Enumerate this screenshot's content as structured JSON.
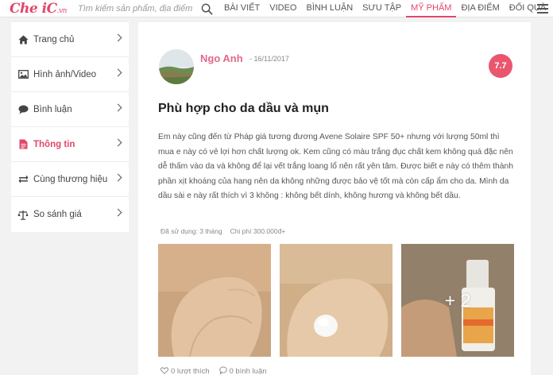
{
  "header": {
    "logo_main": "Che iC",
    "logo_suffix": ".vn",
    "search_placeholder": "Tìm kiếm sản phẩm, địa điểm",
    "nav": [
      {
        "label": "BÀI VIẾT"
      },
      {
        "label": "VIDEO"
      },
      {
        "label": "BÌNH LUẬN"
      },
      {
        "label": "SƯU TẬP"
      },
      {
        "label": "MỸ PHẨM",
        "active": true
      },
      {
        "label": "ĐỊA ĐIỂM"
      },
      {
        "label": "ĐỔI QUÀ"
      }
    ]
  },
  "sidebar": {
    "items": [
      {
        "label": "Trang chủ",
        "icon": "home-icon"
      },
      {
        "label": "Hình ảnh/Video",
        "icon": "image-icon"
      },
      {
        "label": "Bình luận",
        "icon": "comment-icon"
      },
      {
        "label": "Thông tin",
        "icon": "document-icon",
        "active": true
      },
      {
        "label": "Cùng thương hiệu",
        "icon": "exchange-icon"
      },
      {
        "label": "So sánh giá",
        "icon": "scale-icon"
      }
    ]
  },
  "review": {
    "author": "Ngo Anh",
    "date": "- 16/11/2017",
    "score": "7.7",
    "title": "Phù hợp cho da dầu và mụn",
    "body": "Em này cũng đến từ Pháp giá tương đương Avene Solaire SPF 50+ nhưng với lượng 50ml thì mua e này có vẻ lợi hơn chất lượng ok. Kem cũng có màu trắng đục chất kem không quá đặc nên dễ thấm vào da và không để lại vết trắng loang lổ nên rất yên tâm. Được biết e này có thêm thành phần xịt khoáng của hang nên da không những được bảo vệ tốt mà còn cấp ẩm cho da. Mình da dầu sài e này rất thích vì 3 không : không bết dính, không hương và không bết dầu.",
    "used_label": "Đã sử dụng:",
    "used_value": "3 tháng",
    "cost_label": "Chi phí",
    "cost_value": "300.000đ+",
    "more_photos": "+ 2",
    "likes": "0 lượt thích",
    "comments": "0 bình luận"
  },
  "colors": {
    "brand": "#e2476a",
    "score_bg": "#e9566e"
  }
}
